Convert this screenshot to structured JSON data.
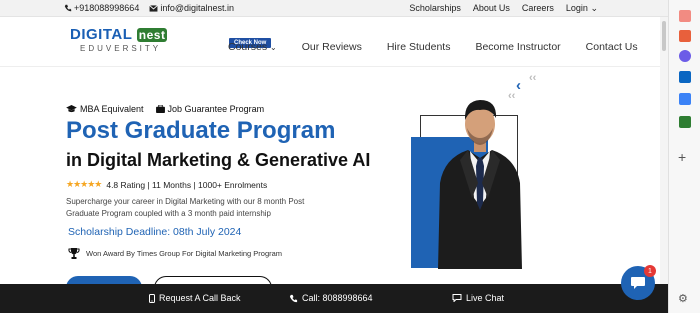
{
  "topbar": {
    "phone": "+918088998664",
    "email": "info@digitalnest.in",
    "links": [
      "Scholarships",
      "About Us",
      "Careers",
      "Login"
    ]
  },
  "header": {
    "logo_brand_part1": "DIGITAL",
    "logo_brand_part2": "nest",
    "logo_sub": "EDUVERSITY",
    "check_now": "Check Now",
    "nav": [
      "Courses",
      "Our Reviews",
      "Hire Students",
      "Become Instructor",
      "Contact Us"
    ]
  },
  "hero": {
    "badge1": "MBA Equivalent",
    "badge2": "Job Guarantee Program",
    "title": "Post Graduate Program",
    "subtitle": "in Digital Marketing & Generative AI",
    "stars": "★★★★★",
    "rating_text": "4.8 Rating | 11 Months | 1000+ Enrolments",
    "description": "Supercharge your career in Digital Marketing with our 8 month Post Graduate Program coupled with a 3 month paid internship",
    "deadline": "Scholarship Deadline: 08th July 2024",
    "award": "Won Award By Times Group For Digital Marketing Program"
  },
  "bottombar": {
    "callback": "Request A Call Back",
    "call": "Call: 8088998664",
    "livechat": "Live Chat"
  },
  "chat_badge": "1",
  "colors": {
    "primary": "#1f63b4",
    "dark": "#1b1b1b",
    "star": "#f5a623"
  }
}
